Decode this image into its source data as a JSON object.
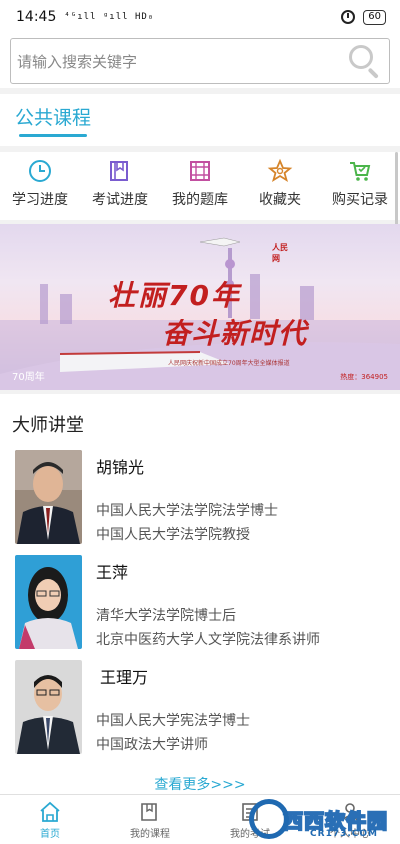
{
  "status_bar": {
    "time": "14:45",
    "signal": "⁴ᴳıll ᵍıll HD₀",
    "battery": "60",
    "icons": [
      "alarm-icon",
      "battery-icon"
    ]
  },
  "search": {
    "placeholder": "请输入搜索关键字",
    "icon": "search-icon"
  },
  "section": {
    "title": "公共课程"
  },
  "quick_nav": [
    {
      "label": "学习进度",
      "icon": "clock-icon",
      "color": "#2aa9d2"
    },
    {
      "label": "考试进度",
      "icon": "book-icon",
      "color": "#7a5ccf"
    },
    {
      "label": "我的题库",
      "icon": "question-bank-icon",
      "color": "#c24fa0"
    },
    {
      "label": "收藏夹",
      "icon": "star-icon",
      "color": "#d6852b"
    },
    {
      "label": "购买记录",
      "icon": "cart-icon",
      "color": "#4bb54a"
    }
  ],
  "banner": {
    "title": "壮丽70年",
    "subtitle": "奋斗新时代",
    "caption": "人民网庆祝新中国成立70周年大型全媒体报道",
    "tag": "70周年",
    "views": "热度：364905",
    "logo": "人民网"
  },
  "teachers": {
    "heading": "大师讲堂",
    "list": [
      {
        "name": "胡锦光",
        "line1": "中国人民大学法学院法学博士",
        "line2": "中国人民大学法学院教授"
      },
      {
        "name": "王萍",
        "line1": "清华大学法学院博士后",
        "line2": "北京中医药大学人文学院法律系讲师"
      },
      {
        "name": "王理万",
        "line1": "中国人民大学宪法学博士",
        "line2": "中国政法大学讲师"
      }
    ],
    "more": "查看更多>>>"
  },
  "tabbar": [
    {
      "label": "首页",
      "icon": "home-icon",
      "active": true
    },
    {
      "label": "我的课程",
      "icon": "course-book-icon",
      "active": false
    },
    {
      "label": "我的考试",
      "icon": "exam-icon",
      "active": false
    },
    {
      "label": "个人中心",
      "icon": "profile-icon",
      "active": false
    }
  ],
  "watermark": {
    "text": "西西软件园",
    "sub": "CR173.COM"
  }
}
